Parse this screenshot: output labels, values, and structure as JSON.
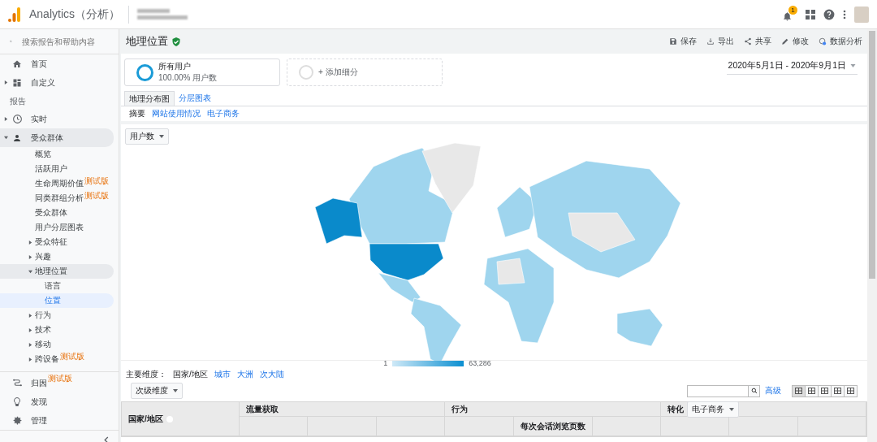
{
  "topbar": {
    "product": "Analytics（分析）",
    "notification_count": "1"
  },
  "sidebar": {
    "search": {
      "placeholder": "搜索报告和帮助内容"
    },
    "items": [
      {
        "kind": "link",
        "label": "首页",
        "selected": false
      },
      {
        "kind": "group",
        "label": "自定义",
        "expanded": false,
        "selected": false
      },
      {
        "kind": "section",
        "label": "报告"
      },
      {
        "kind": "group",
        "label": "实时",
        "expanded": false,
        "selected": false
      },
      {
        "kind": "group",
        "label": "受众群体",
        "expanded": true,
        "selected": false,
        "children": [
          {
            "kind": "link",
            "label": "概览",
            "selected": false
          },
          {
            "kind": "link",
            "label": "活跃用户",
            "selected": false
          },
          {
            "kind": "link",
            "label": "生命周期价值",
            "badge": "测试版",
            "selected": false
          },
          {
            "kind": "link",
            "label": "同类群组分析",
            "badge": "测试版",
            "selected": false
          },
          {
            "kind": "link",
            "label": "受众群体",
            "selected": false
          },
          {
            "kind": "link",
            "label": "用户分层图表",
            "selected": false
          },
          {
            "kind": "group",
            "label": "受众特征",
            "expanded": false,
            "selected": false
          },
          {
            "kind": "group",
            "label": "兴趣",
            "expanded": false,
            "selected": false
          },
          {
            "kind": "group",
            "label": "地理位置",
            "expanded": true,
            "selected": false,
            "children": [
              {
                "kind": "link",
                "label": "语言",
                "selected": false
              },
              {
                "kind": "link",
                "label": "位置",
                "selected": true
              }
            ]
          },
          {
            "kind": "group",
            "label": "行为",
            "expanded": false,
            "selected": false
          },
          {
            "kind": "group",
            "label": "技术",
            "expanded": false,
            "selected": false
          },
          {
            "kind": "group",
            "label": "移动",
            "expanded": false,
            "selected": false
          },
          {
            "kind": "group",
            "label": "跨设备",
            "badge": "测试版",
            "expanded": false,
            "selected": false
          }
        ]
      }
    ],
    "bottom_items": [
      {
        "label": "归因",
        "badge": "测试版",
        "selected": false
      },
      {
        "label": "发现",
        "selected": false
      },
      {
        "label": "管理",
        "selected": false
      }
    ]
  },
  "main": {
    "title": "地理位置",
    "actions": [
      "保存",
      "导出",
      "共享",
      "修改",
      "数据分析"
    ],
    "segments": [
      {
        "kind": "segment",
        "label": "所有用户",
        "detail": "100.00% 用户数"
      },
      {
        "kind": "add",
        "label": "+ 添加细分"
      }
    ],
    "date_range": "2020年5月1日 - 2020年9月1日",
    "tabs": [
      {
        "label": "地理分布图",
        "selected": true
      },
      {
        "label": "分层图表",
        "selected": false
      }
    ],
    "subtabs": [
      {
        "label": "摘要",
        "selected": true
      },
      {
        "label": "网站使用情况",
        "selected": false
      },
      {
        "label": "电子商务",
        "selected": false
      }
    ],
    "metric_dropdown": "用户数",
    "legend": {
      "min": "1",
      "max": "63,286"
    },
    "primary_dimension": {
      "label": "主要维度：",
      "options": [
        {
          "label": "国家/地区",
          "selected": true
        },
        {
          "label": "城市",
          "selected": false
        },
        {
          "label": "大洲",
          "selected": false
        },
        {
          "label": "次大陆",
          "selected": false
        }
      ]
    },
    "secondary_dimension": "次级维度",
    "advanced_link": "高级",
    "table": {
      "first_column": "国家/地区",
      "groups": [
        "流量获取",
        "行为"
      ],
      "conversion": {
        "label": "转化",
        "dropdown": "电子商务"
      },
      "subheader": "每次会话浏览页数"
    }
  }
}
